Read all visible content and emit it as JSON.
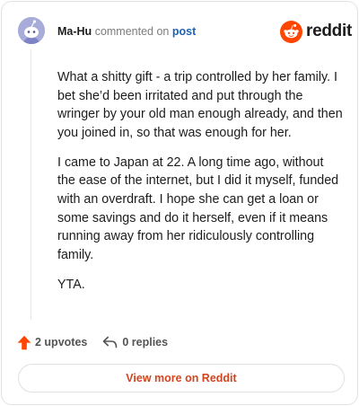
{
  "comment": {
    "username": "Ma-Hu",
    "action_text": "commented on",
    "post_link": "post",
    "paragraphs": [
      "What a shitty gift - a trip controlled by her family. I bet she’d been irritated and put through the wringer by your old man enough already, and then you joined in, so that was enough for her.",
      "I came to Japan at 22. A long time ago, without the ease of the internet, but I did it myself, funded with an overdraft. I hope she can get a loan or some savings and do it herself, even if it means running away from her ridiculously controlling family.",
      "YTA."
    ]
  },
  "brand": {
    "wordmark": "reddit",
    "logo_icon": "reddit-snoo-icon",
    "accent_color": "#ff4500"
  },
  "actions": {
    "upvotes_label": "2 upvotes",
    "upvote_icon": "upvote-arrow-icon",
    "upvote_color": "#ff4500",
    "replies_label": "0 replies",
    "reply_icon": "reply-arrow-icon"
  },
  "footer": {
    "view_more_label": "View more on Reddit",
    "view_more_color": "#d2451e"
  }
}
